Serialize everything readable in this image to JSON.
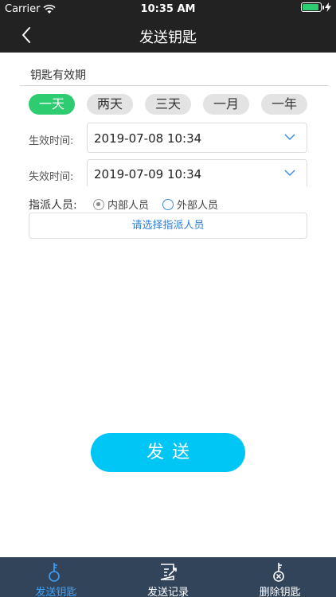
{
  "status_bar": {
    "carrier": "Carrier",
    "time": "10:35 AM",
    "battery_level": 0.9,
    "battery_color": "#2ecc71"
  },
  "nav": {
    "title": "发送钥匙",
    "back_icon": "chevron-left-icon"
  },
  "validity": {
    "section_title": "钥匙有效期",
    "periods": [
      {
        "label": "一天",
        "active": true
      },
      {
        "label": "两天",
        "active": false
      },
      {
        "label": "三天",
        "active": false
      },
      {
        "label": "一月",
        "active": false
      },
      {
        "label": "一年",
        "active": false
      }
    ],
    "start_label": "生效时间:",
    "start_value": "2019-07-08 10:34",
    "end_label": "失效时间:",
    "end_value": "2019-07-09 10:34"
  },
  "assign": {
    "label": "指派人员:",
    "options": [
      {
        "label": "内部人员",
        "checked": true
      },
      {
        "label": "外部人员",
        "checked": false
      }
    ],
    "select_prompt": "请选择指派人员"
  },
  "send_button": "发送",
  "colors": {
    "active_pill": "#2ecc71",
    "send_button": "#00c6f5",
    "tab_bar": "#32445a",
    "active_tab": "#3aa2ff",
    "link": "#2b7ed8"
  },
  "tabs": [
    {
      "label": "发送钥匙",
      "icon": "key-icon",
      "active": true
    },
    {
      "label": "发送记录",
      "icon": "record-icon",
      "active": false
    },
    {
      "label": "删除钥匙",
      "icon": "delete-key-icon",
      "active": false
    }
  ]
}
